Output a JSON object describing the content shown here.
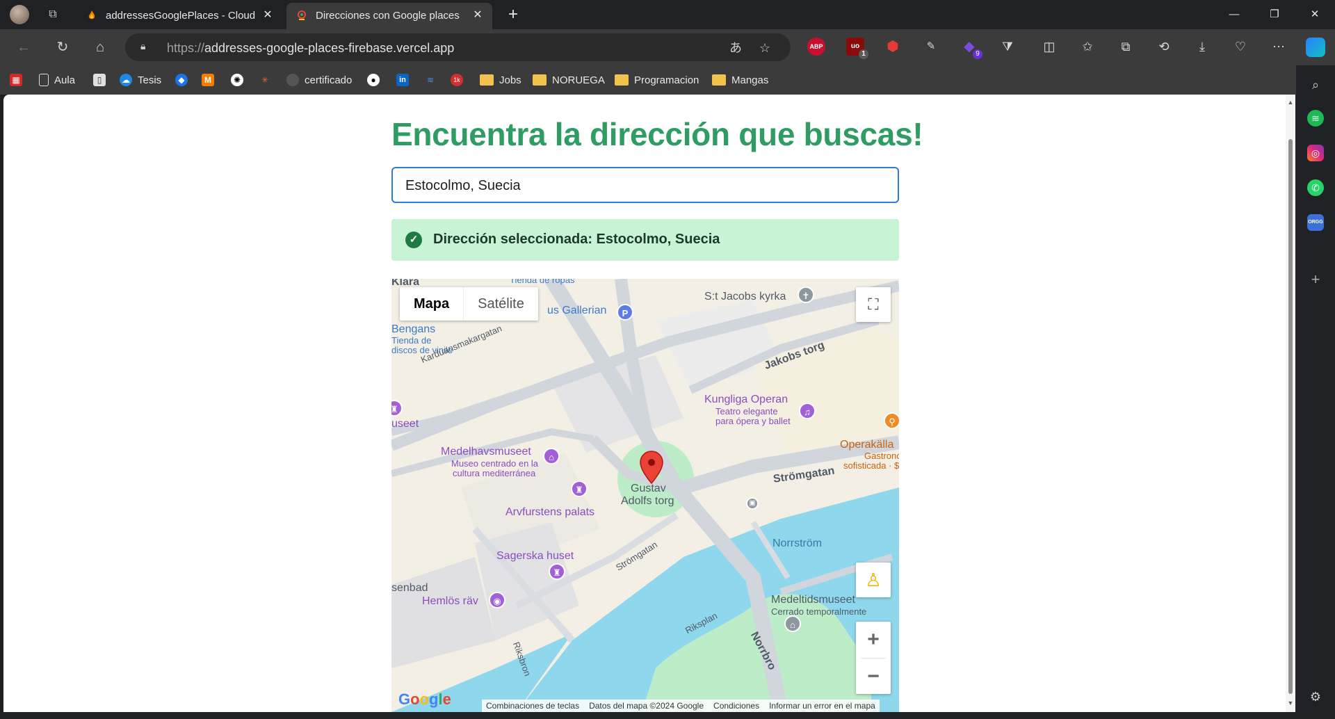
{
  "tabs": [
    {
      "title": "addressesGooglePlaces - Cloud Firestore",
      "active": false,
      "favicon": "firebase-flame-icon"
    },
    {
      "title": "Direcciones con Google places",
      "active": true,
      "favicon": "map-pin-icon"
    }
  ],
  "toolbar": {
    "url_protocol": "https://",
    "url_host": "addresses-google-places-firebase.vercel.app",
    "extensions": [
      {
        "name": "adblock-plus",
        "label": "ABP"
      },
      {
        "name": "ublock-origin",
        "label": "uo",
        "badge": "1"
      },
      {
        "name": "red-shield",
        "label": ""
      },
      {
        "name": "eyedropper",
        "label": ""
      },
      {
        "name": "purple-ext",
        "label": "",
        "badge": "9"
      }
    ]
  },
  "bookmarks": [
    {
      "label": "",
      "icon": "clapper-icon"
    },
    {
      "label": "Aula",
      "icon": "doc-icon"
    },
    {
      "label": "",
      "icon": "mobile-icon"
    },
    {
      "label": "Tesis",
      "icon": "onedrive-icon"
    },
    {
      "label": "",
      "icon": "drop-icon"
    },
    {
      "label": "",
      "icon": "m-logo-icon"
    },
    {
      "label": "",
      "icon": "openai-icon"
    },
    {
      "label": "",
      "icon": "sparkle-icon"
    },
    {
      "label": "certificado",
      "icon": "circle-icon"
    },
    {
      "label": "",
      "icon": "github-icon"
    },
    {
      "label": "",
      "icon": "linkedin-icon"
    },
    {
      "label": "",
      "icon": "stack-icon"
    },
    {
      "label": "",
      "icon": "counter-icon"
    },
    {
      "label": "Jobs",
      "icon": "folder-icon"
    },
    {
      "label": "NORUEGA",
      "icon": "folder-icon"
    },
    {
      "label": "Programacion",
      "icon": "folder-icon"
    },
    {
      "label": "Mangas",
      "icon": "folder-icon"
    }
  ],
  "page": {
    "heading": "Encuentra la dirección que buscas!",
    "search_value": "Estocolmo, Suecia",
    "selected_message": "Dirección seleccionada: Estocolmo, Suecia"
  },
  "map": {
    "type_options": [
      "Mapa",
      "Satélite"
    ],
    "selected_type": "Mapa",
    "labels": {
      "tienda_ropas": "Tienda de ropas",
      "st_jacobs": "S:t Jacobs kyrka",
      "gallerian": "us Gallerian",
      "bengans": "Bengans",
      "bengans_sub1": "Tienda de",
      "bengans_sub2": "discos de vinilo",
      "karduans": "Karduansmakargatan",
      "jakobs_torg": "Jakobs torg",
      "klara": "Klara",
      "useet": "useet",
      "kungliga_operan": "Kungliga Operan",
      "operan_sub1": "Teatro elegante",
      "operan_sub2": "para ópera y ballet",
      "medelhavsmuseet": "Medelhavsmuseet",
      "medel_sub1": "Museo centrado en la",
      "medel_sub2": "cultura mediterránea",
      "operakallaren": "Operakälla",
      "operak_sub1": "Gastrono",
      "operak_sub2": "sofisticada · $",
      "gustav": "Gustav",
      "adolfs_torg": "Adolfs torg",
      "stromgatan": "Strömgatan",
      "arvfurstens": "Arvfurstens palats",
      "norrstrom": "Norrström",
      "sagerska": "Sagerska huset",
      "stromgatan2": "Strömgatan",
      "senbad": "senbad",
      "hemlos": "Hemlös räv",
      "medeltids": "Medeltidsmuseet",
      "medeltids_sub": "Cerrado temporalmente",
      "riksplan": "Riksplan",
      "norrbro": "Norrbro",
      "riksbron": "Riksbron"
    },
    "attribution": [
      "Combinaciones de teclas",
      "Datos del mapa ©2024 Google",
      "Condiciones",
      "Informar un error en el mapa"
    ],
    "google": "Google"
  },
  "colors": {
    "heading": "#2f9d63",
    "alert_bg": "#c9f3d5",
    "input_border": "#2f7bd8",
    "water": "#8fd7ec",
    "park": "#bdecc8"
  }
}
